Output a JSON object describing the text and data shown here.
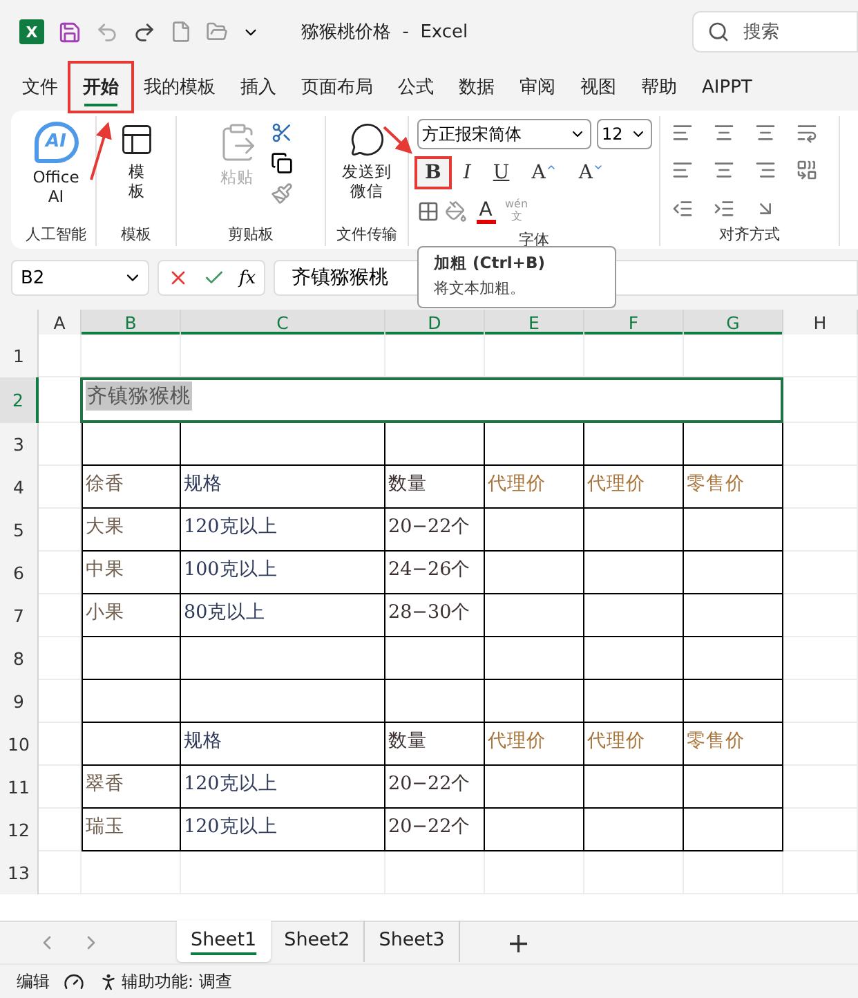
{
  "title_bar": {
    "logo": "X",
    "title": "猕猴桃价格  -  Excel",
    "search": {
      "placeholder": "搜索"
    }
  },
  "ribbon_tabs": [
    {
      "label": "文件",
      "selected": false,
      "annotated": false
    },
    {
      "label": "开始",
      "selected": true,
      "annotated": true
    },
    {
      "label": "我的模板",
      "selected": false,
      "annotated": false
    },
    {
      "label": "插入",
      "selected": false,
      "annotated": false
    },
    {
      "label": "页面布局",
      "selected": false,
      "annotated": false
    },
    {
      "label": "公式",
      "selected": false,
      "annotated": false
    },
    {
      "label": "数据",
      "selected": false,
      "annotated": false
    },
    {
      "label": "审阅",
      "selected": false,
      "annotated": false
    },
    {
      "label": "视图",
      "selected": false,
      "annotated": false
    },
    {
      "label": "帮助",
      "selected": false,
      "annotated": false
    },
    {
      "label": "AIPPT",
      "selected": false,
      "annotated": false
    }
  ],
  "ribbon": {
    "ai": {
      "logo": "AI",
      "label": "Office AI",
      "group": "人工智能"
    },
    "template": {
      "label": "模板",
      "group": "模板"
    },
    "clipboard": {
      "paste": {
        "label": "粘贴",
        "disabled": true
      },
      "group": "剪贴板"
    },
    "transfer": {
      "label": "发送到微信",
      "group": "文件传输"
    },
    "font": {
      "name": "方正报宋简体",
      "size": "12",
      "group": "字体",
      "buttons": [
        {
          "kind": "bold",
          "label": "B",
          "annotated": true
        },
        {
          "kind": "italic",
          "label": "I",
          "annotated": false
        },
        {
          "kind": "underline",
          "label": "U",
          "annotated": false
        },
        {
          "kind": "grow",
          "label": "A",
          "annotated": false
        },
        {
          "kind": "shrink",
          "label": "A",
          "annotated": false
        }
      ],
      "color_button": {
        "label": "A",
        "color": "#e00000"
      },
      "phonetic": {
        "top": "wén",
        "bottom": "文"
      }
    },
    "alignment": {
      "group": "对齐方式"
    }
  },
  "tooltip": {
    "title": "加粗 (Ctrl+B)",
    "body": "将文本加粗。"
  },
  "formula_bar": {
    "name_box": "B2",
    "function_label": "fx",
    "content": "齐镇猕猴桃"
  },
  "columns": [
    {
      "label": "A",
      "selected": false
    },
    {
      "label": "B",
      "selected": true
    },
    {
      "label": "C",
      "selected": true
    },
    {
      "label": "D",
      "selected": true
    },
    {
      "label": "E",
      "selected": true
    },
    {
      "label": "F",
      "selected": true
    },
    {
      "label": "G",
      "selected": true
    },
    {
      "label": "H",
      "selected": false
    }
  ],
  "rows": [
    {
      "number": "1",
      "selected": false,
      "bordered": false
    },
    {
      "number": "2",
      "selected": true,
      "title": "齐镇猕猴桃"
    },
    {
      "number": "3",
      "selected": false,
      "bordered": true
    },
    {
      "number": "4",
      "selected": false,
      "bordered": true,
      "cells": {
        "B": "徐香",
        "C": "规格",
        "D": "数量",
        "E": "代理价",
        "F": "代理价",
        "G": "零售价"
      }
    },
    {
      "number": "5",
      "selected": false,
      "bordered": true,
      "cells": {
        "B": "大果",
        "C": "120克以上",
        "D": "20−22个"
      }
    },
    {
      "number": "6",
      "selected": false,
      "bordered": true,
      "cells": {
        "B": "中果",
        "C": "100克以上",
        "D": "24−26个"
      }
    },
    {
      "number": "7",
      "selected": false,
      "bordered": true,
      "cells": {
        "B": "小果",
        "C": "80克以上",
        "D": "28−30个"
      }
    },
    {
      "number": "8",
      "selected": false,
      "bordered": true
    },
    {
      "number": "9",
      "selected": false,
      "bordered": true
    },
    {
      "number": "10",
      "selected": false,
      "bordered": true,
      "cells": {
        "C": "规格",
        "D": "数量",
        "E": "代理价",
        "F": "代理价",
        "G": "零售价"
      }
    },
    {
      "number": "11",
      "selected": false,
      "bordered": true,
      "cells": {
        "B": "翠香",
        "C": "120克以上",
        "D": "20−22个"
      }
    },
    {
      "number": "12",
      "selected": false,
      "bordered": true,
      "cells": {
        "B": "瑞玉",
        "C": "120克以上",
        "D": "20−22个"
      }
    },
    {
      "number": "13",
      "selected": false,
      "bordered": false
    }
  ],
  "sheet_tabs": [
    {
      "label": "Sheet1",
      "selected": true
    },
    {
      "label": "Sheet2",
      "selected": false
    },
    {
      "label": "Sheet3",
      "selected": false
    }
  ],
  "add_sheet": "+",
  "status_bar": {
    "mode": "编辑",
    "accessibility": "辅助功能: 调查"
  }
}
